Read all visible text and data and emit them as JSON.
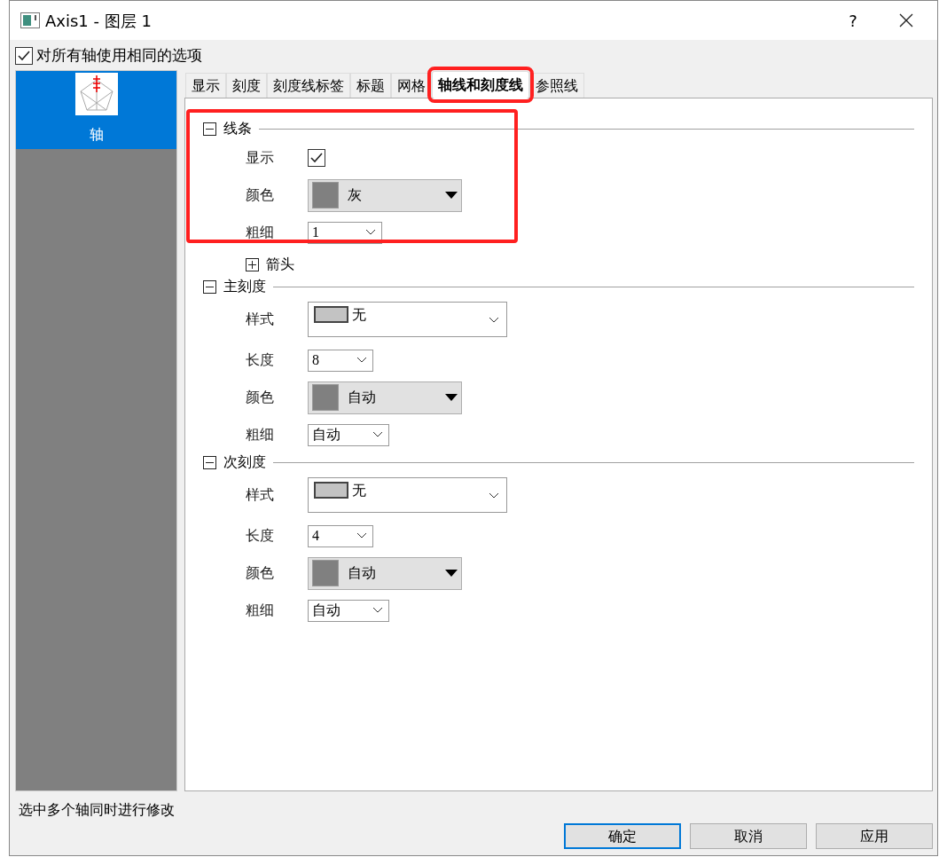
{
  "window": {
    "title": "Axis1 - 图层 1",
    "help": "?"
  },
  "same_options": {
    "label": "对所有轴使用相同的选项",
    "checked": true
  },
  "sidebar": {
    "items": [
      {
        "label": "轴",
        "selected": true
      }
    ]
  },
  "tabs": [
    {
      "label": "显示",
      "selected": false,
      "highlighted": false
    },
    {
      "label": "刻度",
      "selected": false,
      "highlighted": false
    },
    {
      "label": "刻度线标签",
      "selected": false,
      "highlighted": false
    },
    {
      "label": "标题",
      "selected": false,
      "highlighted": false
    },
    {
      "label": "网格",
      "selected": false,
      "highlighted": false
    },
    {
      "label": "轴线和刻度线",
      "selected": true,
      "highlighted": true
    },
    {
      "label": "参照线",
      "selected": false,
      "highlighted": false
    }
  ],
  "sections": [
    {
      "title": "线条",
      "expanded": true,
      "highlighted": true,
      "rows": [
        {
          "kind": "checkbox",
          "label": "显示",
          "checked": true
        },
        {
          "kind": "color",
          "label": "颜色",
          "value": "灰",
          "color": "#808080"
        },
        {
          "kind": "combo",
          "label": "粗细",
          "value": "1"
        },
        {
          "kind": "subsection",
          "label": "箭头",
          "expanded": false
        }
      ]
    },
    {
      "title": "主刻度",
      "expanded": true,
      "highlighted": false,
      "rows": [
        {
          "kind": "style",
          "label": "样式",
          "value": "无"
        },
        {
          "kind": "combo",
          "label": "长度",
          "value": "8"
        },
        {
          "kind": "color",
          "label": "颜色",
          "value": "自动",
          "color": "#808080"
        },
        {
          "kind": "combo",
          "label": "粗细",
          "value": "自动"
        }
      ]
    },
    {
      "title": "次刻度",
      "expanded": true,
      "highlighted": false,
      "rows": [
        {
          "kind": "style",
          "label": "样式",
          "value": "无"
        },
        {
          "kind": "combo",
          "label": "长度",
          "value": "4"
        },
        {
          "kind": "color",
          "label": "颜色",
          "value": "自动",
          "color": "#808080"
        },
        {
          "kind": "combo",
          "label": "粗细",
          "value": "自动"
        }
      ]
    }
  ],
  "status_bar": "选中多个轴同时进行修改",
  "buttons": [
    {
      "label": "确定",
      "default": true
    },
    {
      "label": "取消",
      "default": false
    },
    {
      "label": "应用",
      "default": false
    }
  ]
}
